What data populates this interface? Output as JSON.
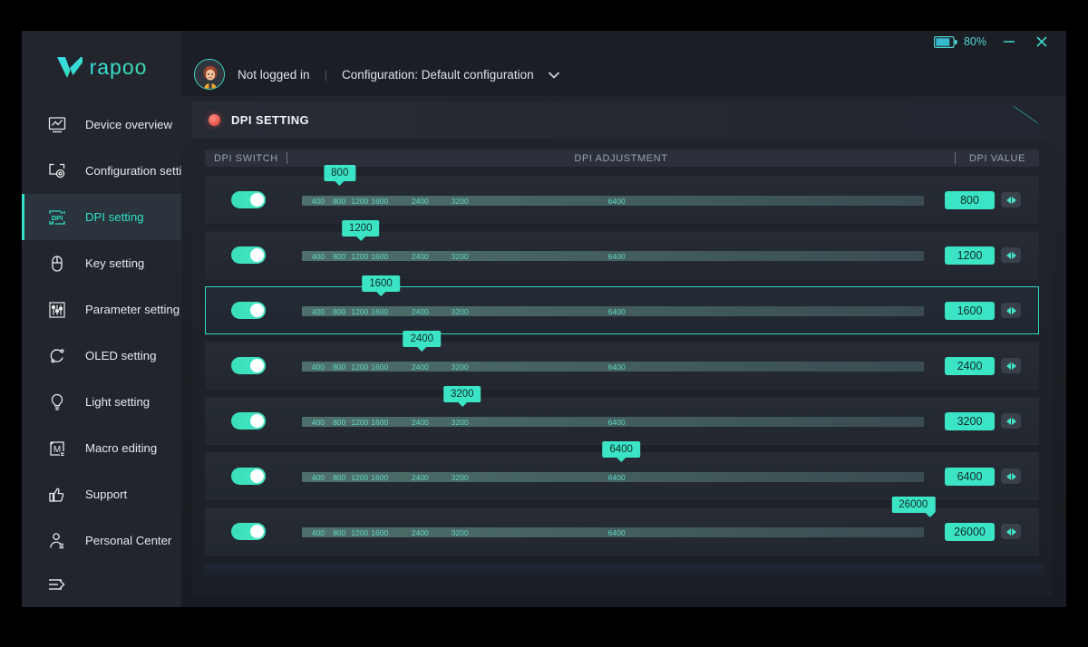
{
  "brand": {
    "name": "rapoo",
    "logo_icon": "rapoo-v-logo"
  },
  "titlebar": {
    "battery_icon": "battery-icon",
    "battery_percent": "80%",
    "minimize_label": "–",
    "close_label": "✕"
  },
  "userbar": {
    "avatar_icon": "user-avatar",
    "login_status": "Not logged in",
    "separator": "|",
    "configuration": "Configuration: Default configuration",
    "caret_icon": "chevron-down-icon"
  },
  "sidebar": {
    "items": [
      {
        "label": "Device overview",
        "icon": "chart-monitor-icon",
        "active": false
      },
      {
        "label": "Configuration setting",
        "icon": "config-gear-icon",
        "active": false
      },
      {
        "label": "DPI setting",
        "icon": "dpi-icon",
        "active": true
      },
      {
        "label": "Key setting",
        "icon": "mouse-icon",
        "active": false
      },
      {
        "label": "Parameter setting",
        "icon": "sliders-icon",
        "active": false
      },
      {
        "label": "OLED setting",
        "icon": "refresh-circle-icon",
        "active": false
      },
      {
        "label": "Light setting",
        "icon": "lightbulb-icon",
        "active": false
      },
      {
        "label": "Macro editing",
        "icon": "macro-m-icon",
        "active": false
      },
      {
        "label": "Support",
        "icon": "thumbs-up-icon",
        "active": false
      },
      {
        "label": "Personal Center",
        "icon": "person-icon",
        "active": false
      }
    ],
    "collapse_icon": "collapse-menu-icon"
  },
  "panel": {
    "status_dot": "red-status-dot",
    "title": "DPI SETTING",
    "columns": {
      "switch": "DPI SWITCH",
      "adjustment": "DPI ADJUSTMENT",
      "value": "DPI VALUE"
    }
  },
  "slider": {
    "ticks": [
      {
        "label": "400",
        "pct": 2.6
      },
      {
        "label": "800",
        "pct": 6.0
      },
      {
        "label": "1200",
        "pct": 9.3
      },
      {
        "label": "1600",
        "pct": 12.5
      },
      {
        "label": "2400",
        "pct": 19.0
      },
      {
        "label": "3200",
        "pct": 25.4
      },
      {
        "label": "6400",
        "pct": 50.6
      }
    ]
  },
  "dpi_rows": [
    {
      "enabled": true,
      "value": "800",
      "bubble": "800",
      "bubble_pct": 6.0,
      "selected": false
    },
    {
      "enabled": true,
      "value": "1200",
      "bubble": "1200",
      "bubble_pct": 9.3,
      "selected": false
    },
    {
      "enabled": true,
      "value": "1600",
      "bubble": "1600",
      "bubble_pct": 12.5,
      "selected": true
    },
    {
      "enabled": true,
      "value": "2400",
      "bubble": "2400",
      "bubble_pct": 19.0,
      "selected": false
    },
    {
      "enabled": true,
      "value": "3200",
      "bubble": "3200",
      "bubble_pct": 25.4,
      "selected": false
    },
    {
      "enabled": true,
      "value": "6400",
      "bubble": "6400",
      "bubble_pct": 50.6,
      "selected": false
    },
    {
      "enabled": true,
      "value": "26000",
      "bubble": "26000",
      "bubble_pct": 99.5,
      "selected": false
    }
  ],
  "colors": {
    "accent": "#3ce4c6",
    "accent_dark": "#2bb5a4",
    "window_bg": "#21242b",
    "sidebar_bg": "#22252c",
    "row_bg": "#262b34",
    "status_red": "#e2514b"
  }
}
